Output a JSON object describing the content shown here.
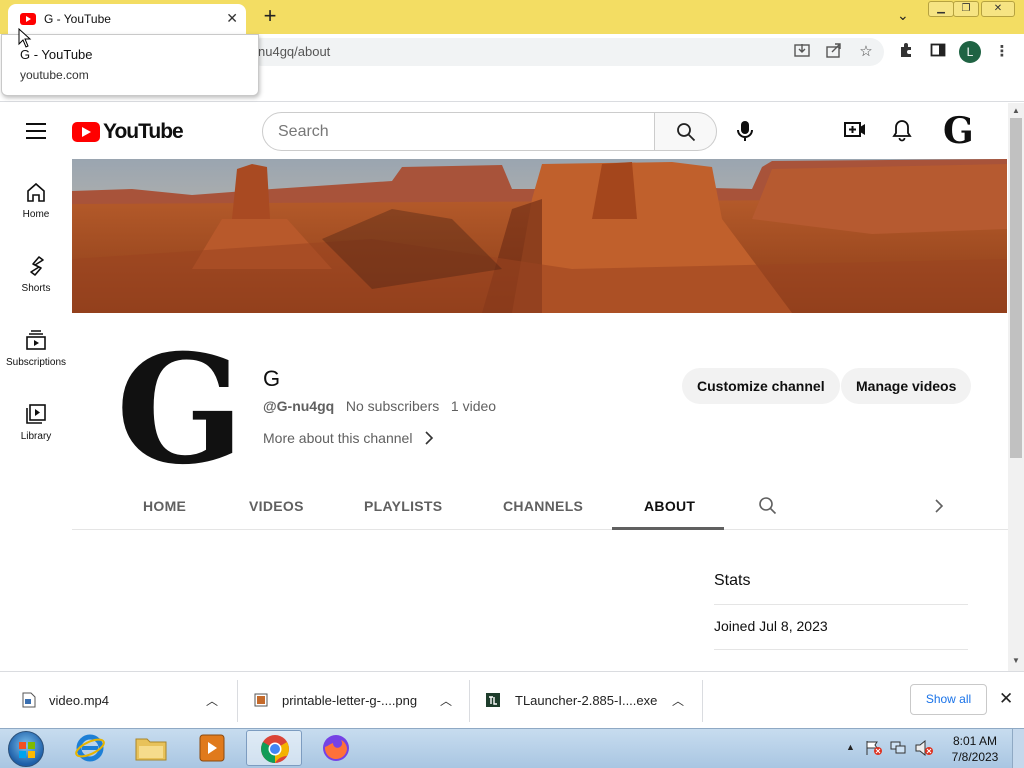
{
  "browser": {
    "tab_title": "G - YouTube",
    "url_partial": "nu4gq/about",
    "profile_initial": "L",
    "tooltip": {
      "title": "G - YouTube",
      "domain": "youtube.com"
    }
  },
  "youtube": {
    "logo_text": "YouTube",
    "search_placeholder": "Search",
    "avatar_letter": "G",
    "nav": [
      {
        "label": "Home",
        "icon": "home-icon"
      },
      {
        "label": "Shorts",
        "icon": "shorts-icon"
      },
      {
        "label": "Subscriptions",
        "icon": "subscriptions-icon"
      },
      {
        "label": "Library",
        "icon": "library-icon"
      }
    ],
    "channel": {
      "logo_letter": "G",
      "name": "G",
      "handle": "@G-nu4gq",
      "subscribers": "No subscribers",
      "videos": "1 video",
      "more_link": "More about this channel",
      "customize_button": "Customize channel",
      "manage_button": "Manage videos"
    },
    "tabs": [
      "HOME",
      "VIDEOS",
      "PLAYLISTS",
      "CHANNELS",
      "ABOUT"
    ],
    "active_tab": "ABOUT",
    "stats": {
      "heading": "Stats",
      "joined": "Joined Jul 8, 2023"
    }
  },
  "downloads": {
    "items": [
      {
        "name": "video.mp4"
      },
      {
        "name": "printable-letter-g-....png"
      },
      {
        "name": "TLauncher-2.885-I....exe"
      }
    ],
    "show_all": "Show all"
  },
  "taskbar": {
    "time": "8:01 AM",
    "date": "7/8/2023"
  },
  "colors": {
    "chrome_tabstrip": "#f3dd63",
    "youtube_red": "#ff0000",
    "profile": "#1f6343",
    "taskbar": "#b8d1ea"
  }
}
